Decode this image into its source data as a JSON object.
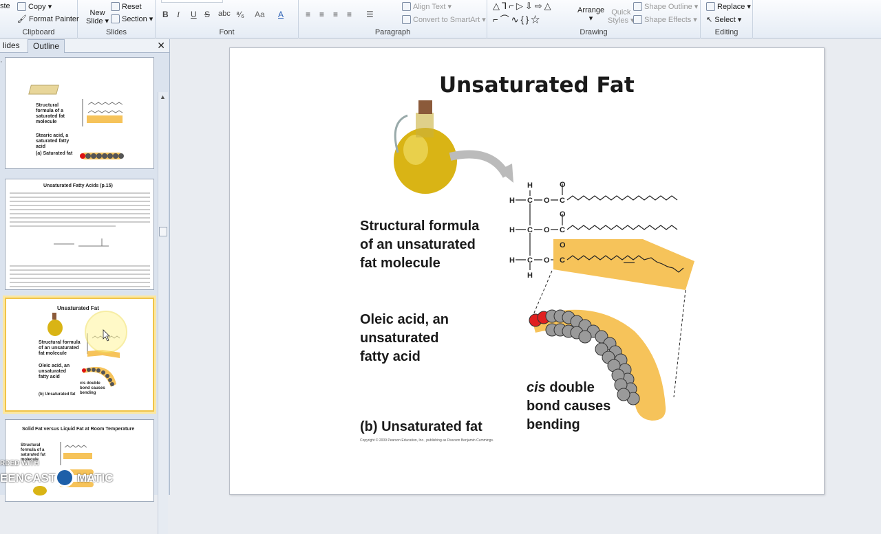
{
  "ribbon": {
    "clipboard": {
      "paste_partial": "ste",
      "copy": "Copy",
      "format_painter": "Format Painter",
      "label": "Clipboard"
    },
    "slides": {
      "new_slide_1": "New",
      "new_slide_2": "Slide",
      "reset": "Reset",
      "section": "Section",
      "label": "Slides"
    },
    "font": {
      "label": "Font"
    },
    "paragraph": {
      "align_text": "Align Text",
      "convert_smartart": "Convert to SmartArt",
      "label": "Paragraph"
    },
    "drawing": {
      "arrange": "Arrange",
      "quick_styles_1": "Quick",
      "quick_styles_2": "Styles",
      "shape_outline": "Shape Outline",
      "shape_effects": "Shape Effects",
      "label": "Drawing"
    },
    "editing": {
      "replace": "Replace",
      "select": "Select",
      "label": "Editing"
    }
  },
  "panel": {
    "tab_slides": "lides",
    "tab_outline": "Outline",
    "thumb1": {
      "lines": [
        "Structural",
        "formula of a",
        "saturated fat",
        "molecule"
      ],
      "caption1": "Stearic acid, a",
      "caption2": "saturated fatty",
      "caption3": "acid",
      "caption4": "(a) Saturated fat"
    },
    "thumb2": {
      "title": "Unsaturated  Fatty Acids (p.15)"
    },
    "thumb3": {
      "title": "Unsaturated Fat",
      "l1": "Structural formula",
      "l2": "of an unsaturated",
      "l3": "fat molecule",
      "o1": "Oleic acid, an",
      "o2": "unsaturated",
      "o3": "fatty acid",
      "c1": "cis double",
      "c2": "bond causes",
      "c3": "bending",
      "b": "(b) Unsaturated fat"
    },
    "thumb4": {
      "title": "Solid Fat versus Liquid Fat at Room Temperature",
      "lines": [
        "Structural",
        "formula of a",
        "saturated fat",
        "molecule"
      ]
    }
  },
  "slide": {
    "title": "Unsaturated Fat",
    "structural": [
      "Structural formula",
      "of an unsaturated",
      "fat molecule"
    ],
    "oleic": [
      "Oleic acid, an",
      "unsaturated",
      "fatty acid"
    ],
    "cis_word": "cis",
    "cis_rest": " double",
    "cis_lines": [
      "bond causes",
      "bending"
    ],
    "caption": "(b) Unsaturated fat",
    "copyright": "Copyright © 2009 Pearson Education, Inc., publishing as Pearson Benjamin Cummings.",
    "atoms": {
      "H": "H",
      "C": "C",
      "O": "O"
    }
  },
  "watermark": {
    "line1": "RDED WITH",
    "line2": "EENCAST",
    "line3": "MATIC"
  },
  "colors": {
    "accent": "#f0c44a",
    "fat": "#f6c35a",
    "oil": "#d9b415"
  }
}
